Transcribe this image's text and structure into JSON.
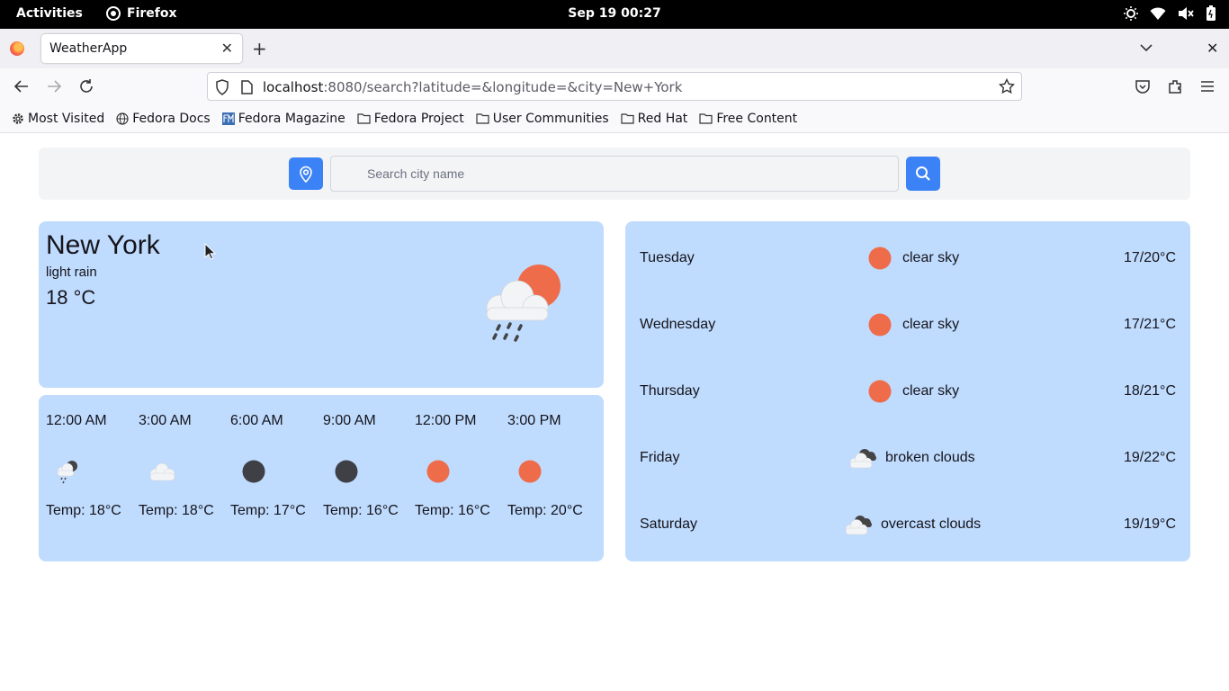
{
  "system": {
    "activities": "Activities",
    "app_name": "Firefox",
    "clock": "Sep 19  00:27"
  },
  "browser": {
    "tab_title": "WeatherApp",
    "url_host": "localhost",
    "url_rest": ":8080/search?latitude=&longitude=&city=New+York",
    "bookmarks": [
      {
        "label": "Most Visited",
        "icon": "gear-icon"
      },
      {
        "label": "Fedora Docs",
        "icon": "globe-icon"
      },
      {
        "label": "Fedora Magazine",
        "icon": "fm-icon"
      },
      {
        "label": "Fedora Project",
        "icon": "folder-icon"
      },
      {
        "label": "User Communities",
        "icon": "folder-icon"
      },
      {
        "label": "Red Hat",
        "icon": "folder-icon"
      },
      {
        "label": "Free Content",
        "icon": "folder-icon"
      }
    ]
  },
  "search": {
    "placeholder": "Search city name",
    "value": ""
  },
  "colors": {
    "card": "#bfdbfe",
    "button": "#3b82f6",
    "sun": "#ef6c4a",
    "moon": "#3f3f46"
  },
  "current": {
    "city": "New York",
    "description": "light rain",
    "temperature": "18 °C",
    "icon": "cloud-sun-rain-icon"
  },
  "hourly": [
    {
      "time": "12:00 AM",
      "temp": "Temp: 18°C",
      "icon": "cloud-rain-icon"
    },
    {
      "time": "3:00 AM",
      "temp": "Temp: 18°C",
      "icon": "cloud-icon"
    },
    {
      "time": "6:00 AM",
      "temp": "Temp: 17°C",
      "icon": "moon-icon"
    },
    {
      "time": "9:00 AM",
      "temp": "Temp: 16°C",
      "icon": "moon-icon"
    },
    {
      "time": "12:00 PM",
      "temp": "Temp: 16°C",
      "icon": "sun-icon"
    },
    {
      "time": "3:00 PM",
      "temp": "Temp: 20°C",
      "icon": "sun-icon"
    }
  ],
  "forecast": [
    {
      "day": "Tuesday",
      "description": "clear sky",
      "temp": "17/20°C",
      "icon": "sun-icon"
    },
    {
      "day": "Wednesday",
      "description": "clear sky",
      "temp": "17/21°C",
      "icon": "sun-icon"
    },
    {
      "day": "Thursday",
      "description": "clear sky",
      "temp": "18/21°C",
      "icon": "sun-icon"
    },
    {
      "day": "Friday",
      "description": "broken clouds",
      "temp": "19/22°C",
      "icon": "broken-clouds-icon"
    },
    {
      "day": "Saturday",
      "description": "overcast clouds",
      "temp": "19/19°C",
      "icon": "overcast-clouds-icon"
    }
  ]
}
